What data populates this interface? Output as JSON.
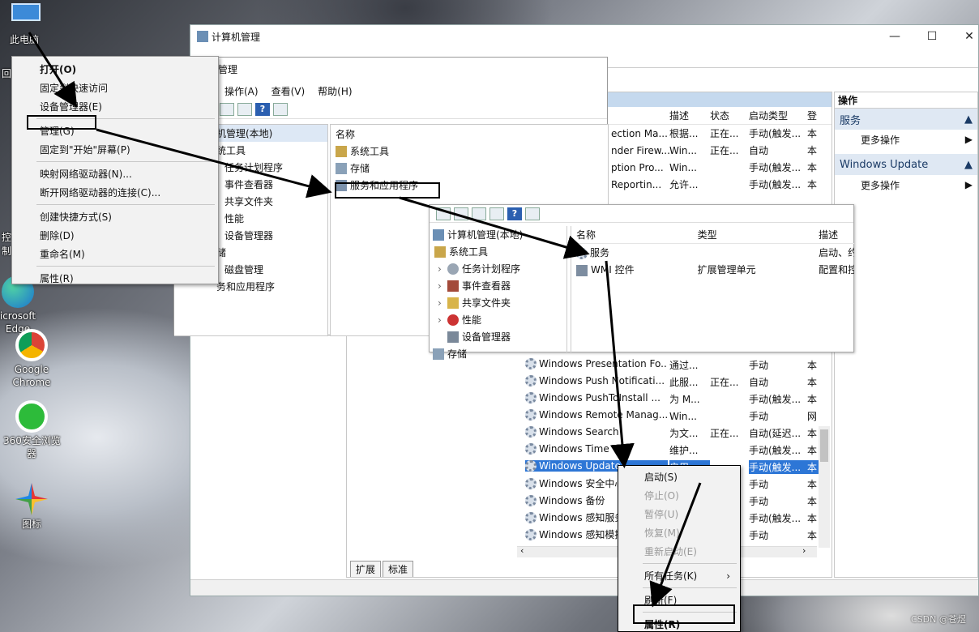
{
  "desktop": {
    "icons": [
      {
        "label": "此电脑"
      },
      {
        "label": "icrosoft\nEdge"
      },
      {
        "label": "Google\nChrome"
      },
      {
        "label": "360安全浏览\n器"
      },
      {
        "label": "图标"
      }
    ],
    "partial_labels": [
      "回",
      "控制"
    ]
  },
  "desktop_menu": {
    "items": [
      {
        "label": "打开(O)",
        "bold": true
      },
      {
        "label": "固定到快速访问"
      },
      {
        "label": "设备管理器(E)"
      },
      {
        "label": "管理(G)",
        "highlight": true
      },
      {
        "label": "固定到\"开始\"屏幕(P)"
      },
      {
        "label": "映射网络驱动器(N)..."
      },
      {
        "label": "断开网络驱动器的连接(C)..."
      },
      {
        "label": "创建快捷方式(S)"
      },
      {
        "label": "删除(D)"
      },
      {
        "label": "重命名(M)"
      },
      {
        "label": "属性(R)"
      }
    ]
  },
  "main_window": {
    "title": "计算机管理",
    "caption": {
      "minimize": "—",
      "maximize": "☐",
      "close": "✕"
    },
    "services_list": {
      "columns": [
        "描述",
        "状态",
        "启动类型",
        "登"
      ],
      "top_rows": [
        {
          "name": "ection Ma...",
          "desc": "根据...",
          "status": "正在...",
          "startup": "手动(触发...",
          "logon": "本"
        },
        {
          "name": "nder Firew...",
          "desc": "Win...",
          "status": "正在...",
          "startup": "自动",
          "logon": "本"
        },
        {
          "name": "ption Pro...",
          "desc": "Win...",
          "status": "",
          "startup": "手动(触发...",
          "logon": "本"
        },
        {
          "name": "Reportin...",
          "desc": "允许...",
          "status": "",
          "startup": "手动(触发...",
          "logon": "本"
        }
      ],
      "rows": [
        {
          "name": "Windows Presentation Fo...",
          "desc": "通过...",
          "status": "",
          "startup": "手动",
          "logon": "本"
        },
        {
          "name": "Windows Push Notificati...",
          "desc": "此服...",
          "status": "正在...",
          "startup": "自动",
          "logon": "本"
        },
        {
          "name": "Windows PushToInstall ...",
          "desc": "为 M...",
          "status": "",
          "startup": "手动(触发...",
          "logon": "本"
        },
        {
          "name": "Windows Remote Manag...",
          "desc": "Win...",
          "status": "",
          "startup": "手动",
          "logon": "网"
        },
        {
          "name": "Windows Search",
          "desc": "为文...",
          "status": "正在...",
          "startup": "自动(延迟...",
          "logon": "本"
        },
        {
          "name": "Windows Time",
          "desc": "维护...",
          "status": "",
          "startup": "手动(触发...",
          "logon": "本"
        },
        {
          "name": "Windows Update",
          "desc": "启用...",
          "status": "",
          "startup": "手动(触发...",
          "logon": "本",
          "selected": true
        },
        {
          "name": "Windows 安全中心",
          "desc": "",
          "status": "",
          "startup": "手动",
          "logon": "本"
        },
        {
          "name": "Windows 备份",
          "desc": "",
          "status": "",
          "startup": "手动",
          "logon": "本"
        },
        {
          "name": "Windows 感知服务",
          "desc": "",
          "status": "",
          "startup": "手动(触发...",
          "logon": "本"
        },
        {
          "name": "Windows 感知模拟",
          "desc": "",
          "status": "",
          "startup": "手动",
          "logon": "本"
        }
      ],
      "tabs": [
        "扩展",
        "标准"
      ]
    },
    "actions": {
      "header": "操作",
      "sections": [
        {
          "title": "服务",
          "items": [
            "更多操作"
          ]
        },
        {
          "title": "Windows Update",
          "items": [
            "更多操作"
          ]
        }
      ]
    }
  },
  "second_window": {
    "title": "机管理",
    "menu": [
      "操作(A)",
      "查看(V)",
      "帮助(H)"
    ],
    "tree": [
      "机管理(本地)",
      "统工具",
      "任务计划程序",
      "事件查看器",
      "共享文件夹",
      "性能",
      "设备管理器",
      "储",
      "磁盘管理",
      "务和应用程序"
    ],
    "list_header": "名称",
    "list": [
      "系统工具",
      "存储",
      "服务和应用程序"
    ]
  },
  "third_window": {
    "tree": [
      "计算机管理(本地)",
      "系统工具",
      "任务计划程序",
      "事件查看器",
      "共享文件夹",
      "性能",
      "设备管理器",
      "存储"
    ],
    "columns": [
      "名称",
      "类型",
      "描述"
    ],
    "rows": [
      {
        "name": "服务",
        "type": "",
        "desc": "启动、约"
      },
      {
        "name": "WMI 控件",
        "type": "扩展管理单元",
        "desc": "配置和控"
      }
    ]
  },
  "service_menu": {
    "items": [
      {
        "label": "启动(S)",
        "disabled": false
      },
      {
        "label": "停止(O)",
        "disabled": true
      },
      {
        "label": "暂停(U)",
        "disabled": true
      },
      {
        "label": "恢复(M)",
        "disabled": true
      },
      {
        "label": "重新启动(E)",
        "disabled": true
      },
      {
        "label": "所有任务(K)",
        "disabled": false,
        "submenu": true
      },
      {
        "label": "刷新(F)",
        "disabled": false
      },
      {
        "label": "属性(R)",
        "disabled": false,
        "bold": true,
        "highlight": true
      }
    ]
  },
  "watermark": "CSDN @苍煜"
}
